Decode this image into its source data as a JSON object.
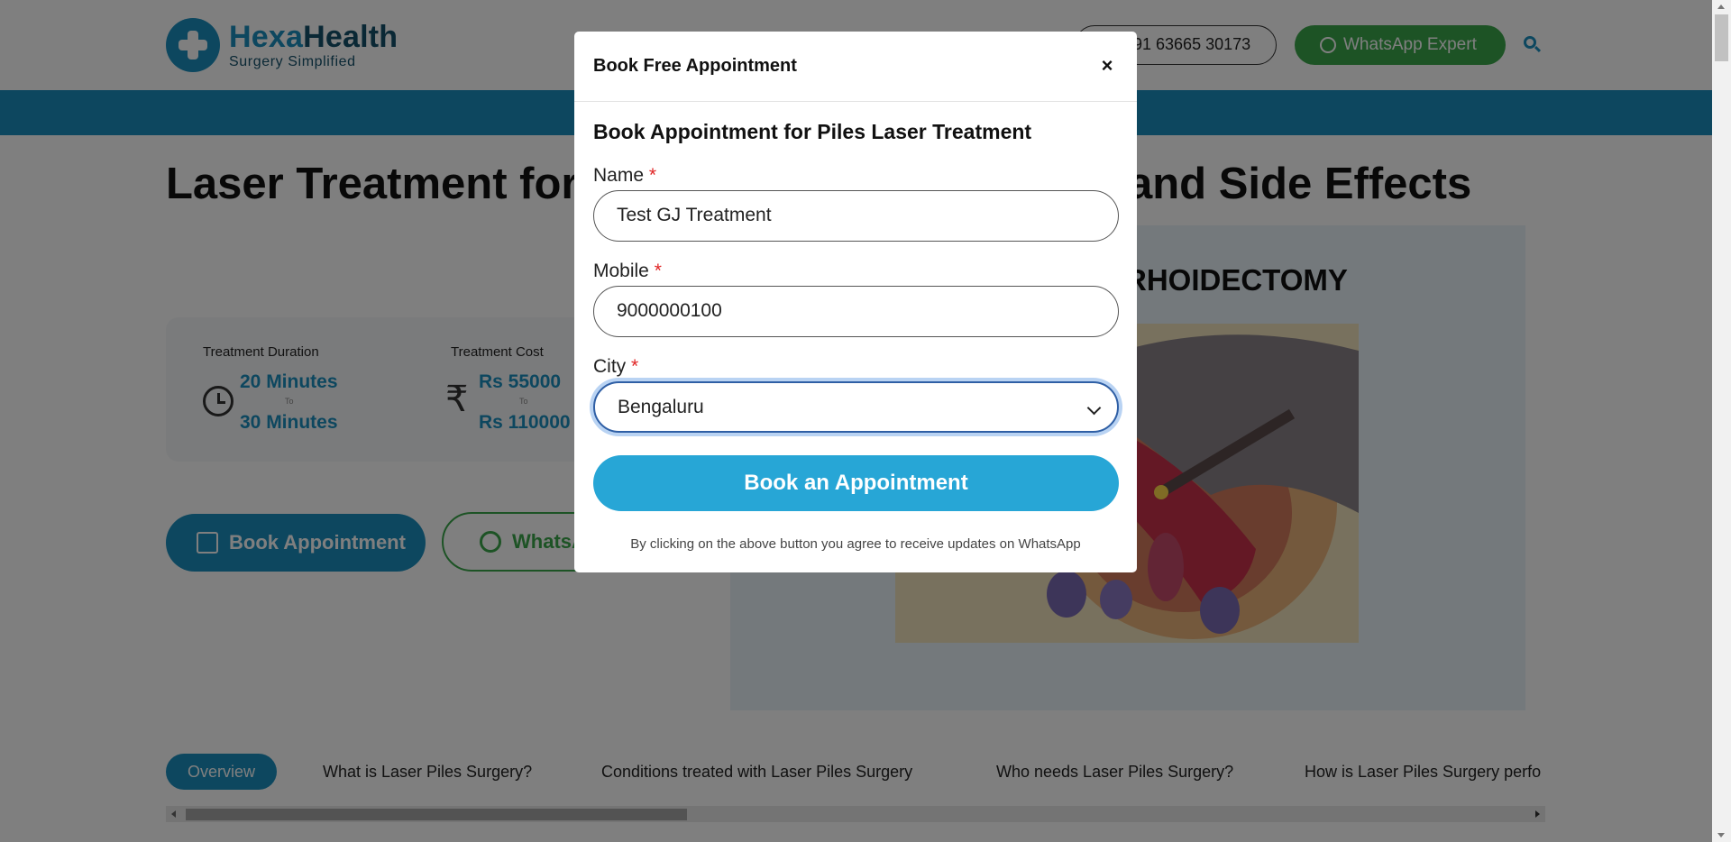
{
  "header": {
    "logo_brand_part1": "Hexa",
    "logo_brand_part2": "Health",
    "logo_tagline": "Surgery Simplified",
    "phone_label": "91 63665 30173",
    "whatsapp_expert_label": "WhatsApp Expert",
    "search_icon": "search-icon"
  },
  "page": {
    "title_left": "Laser Treatment for",
    "title_right": "and Side Effects",
    "info": {
      "duration_label": "Treatment Duration",
      "duration_min": "20 Minutes",
      "duration_max": "30 Minutes",
      "cost_label": "Treatment Cost",
      "cost_min": "Rs 55000",
      "cost_max": "Rs 110000",
      "to_label": "To"
    },
    "book_button": "Book Appointment",
    "whatsapp_button": "WhatsA",
    "media_heading": "RHOIDECTOMY"
  },
  "tabs": [
    {
      "label": "Overview",
      "active": true
    },
    {
      "label": "What is Laser Piles Surgery?"
    },
    {
      "label": "Conditions treated with Laser Piles Surgery"
    },
    {
      "label": "Who needs Laser Piles Surgery?"
    },
    {
      "label": "How is Laser Piles Surgery perfo"
    }
  ],
  "modal": {
    "title": "Book Free Appointment",
    "close_label": "×",
    "heading": "Book Appointment for Piles Laser Treatment",
    "name_label": "Name",
    "name_value": "Test GJ Treatment",
    "mobile_label": "Mobile",
    "mobile_value": "9000000100",
    "city_label": "City",
    "city_value": "Bengaluru",
    "required_mark": "*",
    "submit_label": "Book an Appointment",
    "consent": "By clicking on the above button you agree to receive updates on WhatsApp"
  },
  "colors": {
    "brand_blue": "#1a8fbf",
    "whatsapp_green": "#3aa64a",
    "submit_blue": "#27a6d6",
    "overlay": "rgba(0,0,0,0.5)"
  }
}
